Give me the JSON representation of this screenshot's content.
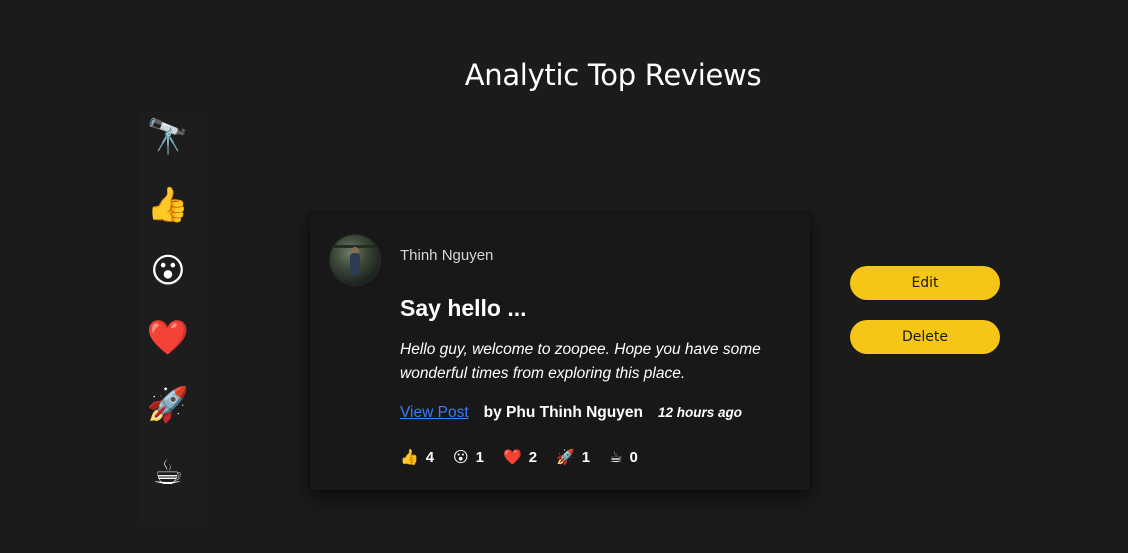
{
  "page": {
    "title": "Analytic Top Reviews"
  },
  "sidebar": {
    "items": [
      {
        "name": "binoculars-icon",
        "glyph": "🔭"
      },
      {
        "name": "thumbs-up-icon",
        "glyph": "👍"
      },
      {
        "name": "astonished-face-icon",
        "glyph": "😮"
      },
      {
        "name": "heart-icon",
        "glyph": "❤️"
      },
      {
        "name": "rocket-icon",
        "glyph": "🚀"
      },
      {
        "name": "coffee-icon",
        "glyph": "☕"
      }
    ]
  },
  "card": {
    "author_name": "Thinh Nguyen",
    "post_title": "Say hello ...",
    "post_body": "Hello guy, welcome to zoopee. Hope you have some wonderful times from exploring this place.",
    "view_link_label": "View Post",
    "by_author": "by Phu Thinh Nguyen",
    "time_ago": "12 hours ago",
    "reactions": [
      {
        "icon": "thumbs-up-icon",
        "glyph": "👍",
        "count": "4"
      },
      {
        "icon": "astonished-face-icon",
        "glyph": "😮",
        "count": "1"
      },
      {
        "icon": "heart-icon",
        "glyph": "❤️",
        "count": "2"
      },
      {
        "icon": "rocket-icon",
        "glyph": "🚀",
        "count": "1"
      },
      {
        "icon": "coffee-icon",
        "glyph": "☕",
        "count": "0"
      }
    ]
  },
  "actions": {
    "edit_label": "Edit",
    "delete_label": "Delete"
  },
  "colors": {
    "background": "#1b1b1b",
    "card": "#181818",
    "accent_button": "#f5c518",
    "link": "#3b7bff"
  }
}
